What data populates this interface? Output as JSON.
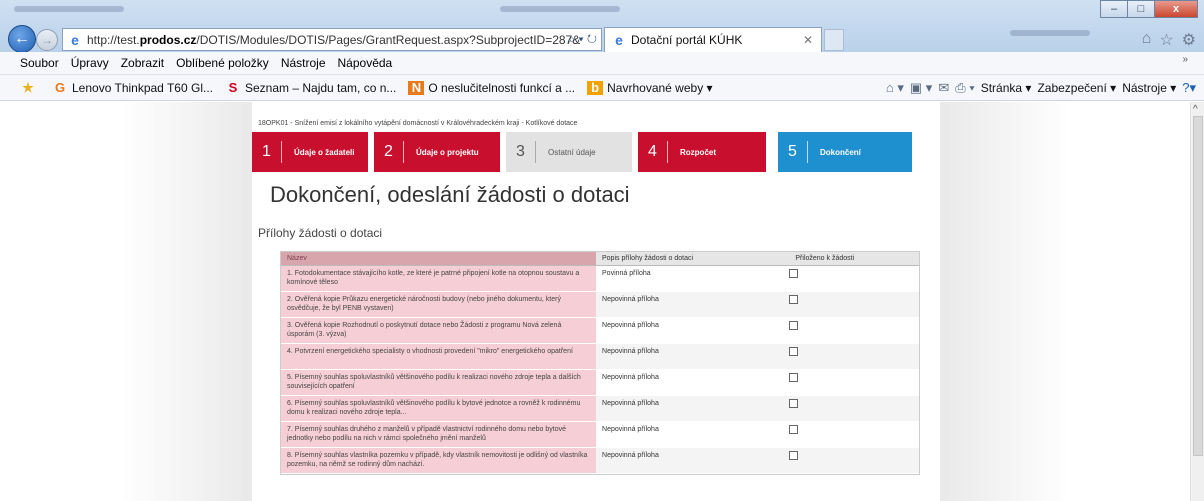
{
  "browser": {
    "address": "http://test.prodos.cz/DOTIS/Modules/DOTIS/Pages/GrantRequest.aspx?SubprojectID=287&",
    "address_domain": "prodos.cz",
    "address_prefix": "http://test.",
    "address_suffix": "/DOTIS/Modules/DOTIS/Pages/GrantRequest.aspx?SubprojectID=287&",
    "tab_title": "Dotační portál KÚHK",
    "window_buttons": [
      "–",
      "□",
      "x"
    ]
  },
  "menubar": [
    "Soubor",
    "Úpravy",
    "Zobrazit",
    "Oblíbené položky",
    "Nástroje",
    "Nápověda"
  ],
  "favorites": [
    {
      "label": "Lenovo Thinkpad T60 Gl...",
      "icon": "lenovo-icon",
      "color": "#e87a1e"
    },
    {
      "label": "Seznam – Najdu tam, co n...",
      "icon": "seznam-icon",
      "color": "#d0021b"
    },
    {
      "label": "O neslučitelnosti funkcí a ...",
      "icon": "news-icon",
      "color": "#e87a1e"
    },
    {
      "label": "Navrhované weby ▾",
      "icon": "bing-icon",
      "color": "#f2a100"
    }
  ],
  "fav_tools": [
    "Stránka ▾",
    "Zabezpečení ▾",
    "Nástroje ▾"
  ],
  "page": {
    "project": "18OPK01 - Snížení emisí z lokálního vytápění domácností v Královéhradeckém kraji - Kotlíkové dotace",
    "steps": [
      {
        "num": "1",
        "label": "Údaje o žadateli",
        "state": "red"
      },
      {
        "num": "2",
        "label": "Údaje o projektu",
        "state": "red"
      },
      {
        "num": "3",
        "label": "Ostatní údaje",
        "state": "gray"
      },
      {
        "num": "4",
        "label": "Rozpočet",
        "state": "red"
      },
      {
        "num": "5",
        "label": "Dokončení",
        "state": "blue"
      }
    ],
    "title": "Dokončení, odeslání žádosti o dotaci",
    "section": "Přílohy žádosti o dotaci",
    "table": {
      "headers": [
        "Název",
        "Popis přílohy žádosti o dotaci",
        "Přiloženo k žádosti"
      ],
      "rows": [
        {
          "name": "1. Fotodokumentace stávajícího kotle, ze které je patrné připojení kotle na otopnou soustavu a komínové těleso",
          "desc": "Povinná příloha"
        },
        {
          "name": "2. Ověřená kopie Průkazu energetické náročnosti budovy (nebo jiného dokumentu, který osvědčuje, že byl PENB vystaven)",
          "desc": "Nepovinná příloha"
        },
        {
          "name": "3. Ověřená kopie Rozhodnutí o poskytnutí dotace nebo Žádosti z programu Nová zelená úsporám (3. výzva)",
          "desc": "Nepovinná příloha"
        },
        {
          "name": "4. Potvrzení energetického specialisty o vhodnosti provedení \"mikro\" energetického opatření",
          "desc": "Nepovinná příloha"
        },
        {
          "name": "5. Písemný souhlas spoluvlastníků většinového podílu k realizaci nového zdroje tepla a dalších souvisejících opatření",
          "desc": "Nepovinná příloha"
        },
        {
          "name": "6. Písemný souhlas spoluvlastníků většinového podílu k bytové jednotce a rovněž k rodinnému domu k realizaci nového zdroje tepla...",
          "desc": "Nepovinná příloha"
        },
        {
          "name": "7. Písemný souhlas druhého z manželů v případě vlastnictví rodinného domu nebo bytové jednotky nebo podílu na nich v rámci společného jmění manželů",
          "desc": "Nepovinná příloha"
        },
        {
          "name": "8. Písemný souhlas vlastníka pozemku v případě, kdy vlastník nemovitosti je odlišný od vlastníka pozemku, na němž se rodinný dům nachází.",
          "desc": "Nepovinná příloha"
        }
      ]
    }
  }
}
